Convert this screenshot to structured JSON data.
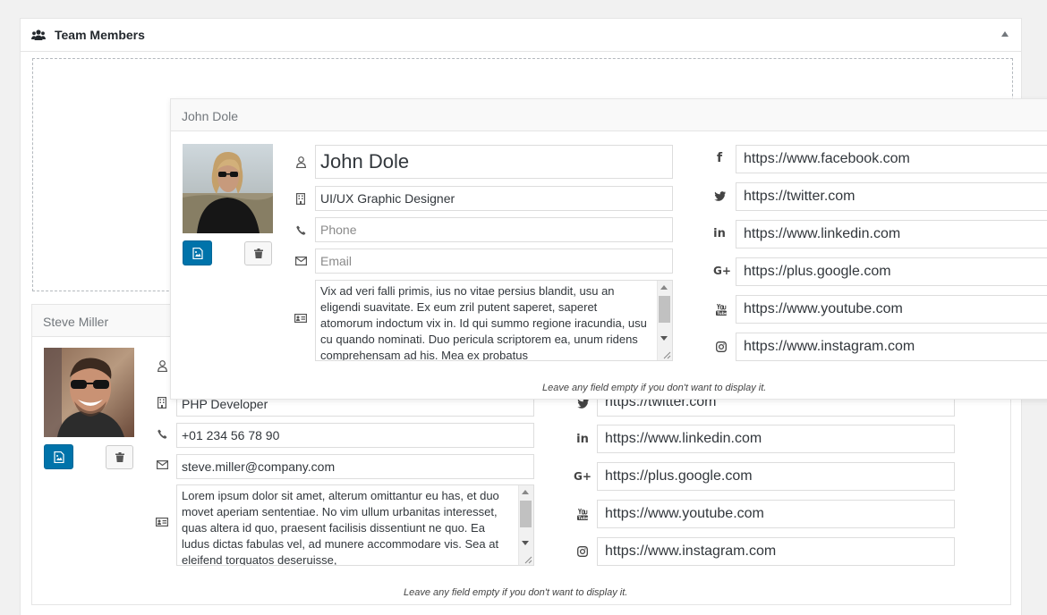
{
  "panel": {
    "title": "Team Members",
    "icon": "users-icon"
  },
  "hint_text": "Leave any field empty if you don't want to display it.",
  "steve": {
    "header": "Steve Miller",
    "name": "",
    "job_title": "PHP Developer",
    "phone": "+01 234 56 78 90",
    "email": "steve.miller@company.com",
    "bio": "Lorem ipsum dolor sit amet, alterum omittantur eu has, et duo movet aperiam sententiae. No vim ullum urbanitas interesset, quas altera id quo, praesent facilisis dissentiunt ne quo. Ea ludus dictas fabulas vel, ad munere accommodare vis. Sea at eleifend torquatos deseruisse,",
    "social": {
      "twitter": "https://twitter.com",
      "linkedin": "https://www.linkedin.com",
      "google": "https://plus.google.com",
      "youtube": "https://www.youtube.com",
      "instagram": "https://www.instagram.com"
    }
  },
  "john": {
    "header": "John Dole",
    "name": "John Dole",
    "job_title": "UI/UX Graphic Designer",
    "phone_placeholder": "Phone",
    "email_placeholder": "Email",
    "bio": "Vix ad veri falli primis, ius no vitae persius blandit, usu an eligendi suavitate. Ex eum zril putent saperet, saperet atomorum indoctum vix in. Id qui summo regione iracundia, usu cu quando nominati. Duo pericula scriptorem ea, unum ridens comprehensam ad his. Mea ex probatus",
    "social": {
      "facebook": "https://www.facebook.com",
      "twitter": "https://twitter.com",
      "linkedin": "https://www.linkedin.com",
      "google": "https://plus.google.com",
      "youtube": "https://www.youtube.com",
      "instagram": "https://www.instagram.com"
    }
  },
  "social_icons": {
    "facebook": "f",
    "twitter": "twitter-icon",
    "linkedin": "in",
    "google": "G+",
    "youtube": "You Tube",
    "instagram": "instagram-icon"
  },
  "colors": {
    "primary_button": "#0073aa",
    "border": "#dddddd",
    "background": "#f1f1f1"
  }
}
